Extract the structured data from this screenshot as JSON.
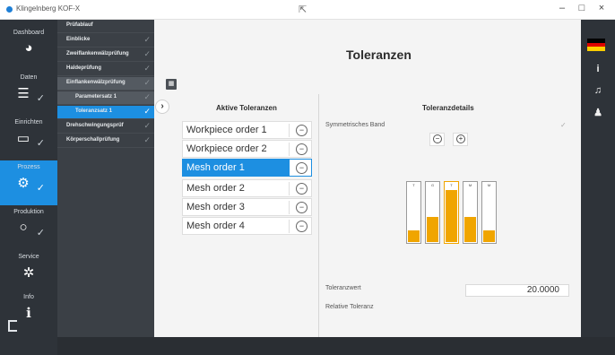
{
  "window": {
    "title": "Klingelnberg KOF-X",
    "minimize": "–",
    "maximize": "□",
    "close": "×"
  },
  "nav": {
    "items": [
      {
        "label": "Dashboard",
        "icon": "dashboard-icon",
        "glyph": "◕"
      },
      {
        "label": "Daten",
        "icon": "data-icon",
        "glyph": "☰"
      },
      {
        "label": "Einrichten",
        "icon": "setup-icon",
        "glyph": "▭"
      },
      {
        "label": "Prozess",
        "icon": "process-icon",
        "glyph": "⚙"
      },
      {
        "label": "Produktion",
        "icon": "production-icon",
        "glyph": "○"
      },
      {
        "label": "Service",
        "icon": "service-icon",
        "glyph": "✲"
      },
      {
        "label": "Info",
        "icon": "info-icon",
        "glyph": "ℹ"
      }
    ]
  },
  "tree": {
    "items": [
      {
        "label": "Prüfablauf"
      },
      {
        "label": "Einblicke"
      },
      {
        "label": "Zweiflankenwälzprüfung"
      },
      {
        "label": "Haldeprüfung"
      },
      {
        "label": "Einflankenwälzprüfung"
      },
      {
        "label": "Parametersatz 1"
      },
      {
        "label": "Toleranzsatz 1"
      },
      {
        "label": "Drehschwingungsprüf"
      },
      {
        "label": "Körperschallprüfung"
      }
    ]
  },
  "page": {
    "title": "Toleranzen",
    "chip_icon": "chip-icon"
  },
  "active_tolerances": {
    "title": "Aktive Toleranzen",
    "rows": [
      {
        "label": "Workpiece order 1"
      },
      {
        "label": "Workpiece order 2"
      },
      {
        "label": "Mesh order 1"
      },
      {
        "label": "Mesh order 2"
      },
      {
        "label": "Mesh order 3"
      },
      {
        "label": "Mesh order 4"
      }
    ],
    "selected_index": 2
  },
  "details": {
    "title": "Toleranzdetails",
    "symmetric_band_label": "Symmetrisches Band",
    "tolerance_value_label": "Toleranzwert",
    "tolerance_value": "20.0000",
    "relative_tolerance_label": "Relative Toleranz",
    "gauges": [
      {
        "label": "T",
        "fill_fraction": 0.2
      },
      {
        "label": "G",
        "fill_fraction": 0.42
      },
      {
        "label": "T",
        "fill_fraction": 0.88
      },
      {
        "label": "M",
        "fill_fraction": 0.42
      },
      {
        "label": "M",
        "fill_fraction": 0.2
      }
    ],
    "active_gauge_index": 2,
    "gauge_color": "#f0a500"
  },
  "rightrail": {
    "flag_colors": [
      "#000000",
      "#dd0000",
      "#ffce00"
    ],
    "info_glyph": "i",
    "bell_glyph": "♫",
    "user_glyph": "♟"
  },
  "colors": {
    "accent": "#1d8fe1",
    "nav_bg": "#2e3339"
  }
}
